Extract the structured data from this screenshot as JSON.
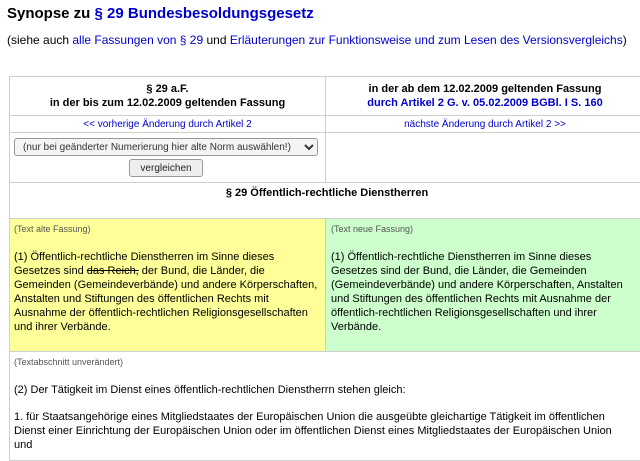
{
  "title": {
    "prefix": "Synopse zu ",
    "link": "§ 29 Bundesbesoldungsgesetz"
  },
  "intro": {
    "open": "(siehe auch ",
    "link1": "alle Fassungen von § 29",
    "mid": " und ",
    "link2": "Erläuterungen zur Funktionsweise und zum Lesen des Versionsvergleichs",
    "close": ")"
  },
  "left_header": {
    "line1": "§ 29 a.F.",
    "line2": "in der bis zum 12.02.2009 geltenden Fassung"
  },
  "right_header": {
    "line1": "in der ab dem 12.02.2009 geltenden Fassung",
    "link": "durch Artikel 2 G. v. 05.02.2009 BGBl. I S. 160"
  },
  "nav": {
    "prev": "<< vorherige Änderung durch Artikel 2",
    "next": "nächste Änderung durch Artikel 2 >>"
  },
  "select": {
    "selected": "(nur bei geänderter Numerierung hier alte Norm auswählen!)"
  },
  "compare_button": "vergleichen",
  "section_title": "§ 29 Öffentlich-rechtliche Dienstherren",
  "old_text": {
    "note": "(Text alte Fassung)",
    "before": "(1) Öffentlich-rechtliche Dienstherren im Sinne dieses Gesetzes sind ",
    "deleted": "das Reich,",
    "after": " der Bund, die Länder, die Gemeinden (Gemeindeverbände) und andere Körperschaften, Anstalten und Stiftungen des öffentlichen Rechts mit Ausnahme der öffentlich-rechtlichen Religionsgesellschaften und ihrer Verbände."
  },
  "new_text": {
    "note": "(Text neue Fassung)",
    "text": "(1) Öffentlich-rechtliche Dienstherren im Sinne dieses Gesetzes sind der Bund, die Länder, die Gemeinden (Gemeindeverbände) und andere Körperschaften, Anstalten und Stiftungen des öffentlichen Rechts mit Ausnahme der öffentlich-rechtlichen Religionsgesellschaften und ihrer Verbände."
  },
  "unchanged": {
    "note": "(Textabschnitt unverändert)",
    "para2": "(2) Der Tätigkeit im Dienst eines öffentlich-rechtlichen Dienstherrn stehen gleich:",
    "item1": "1. für Staatsangehörige eines Mitgliedstaates der Europäischen Union die ausgeübte gleichartige Tätigkeit im öffentlichen Dienst einer Einrichtung der Europäischen Union oder im öffentlichen Dienst eines Mitgliedstaates der Europäischen Union und"
  }
}
